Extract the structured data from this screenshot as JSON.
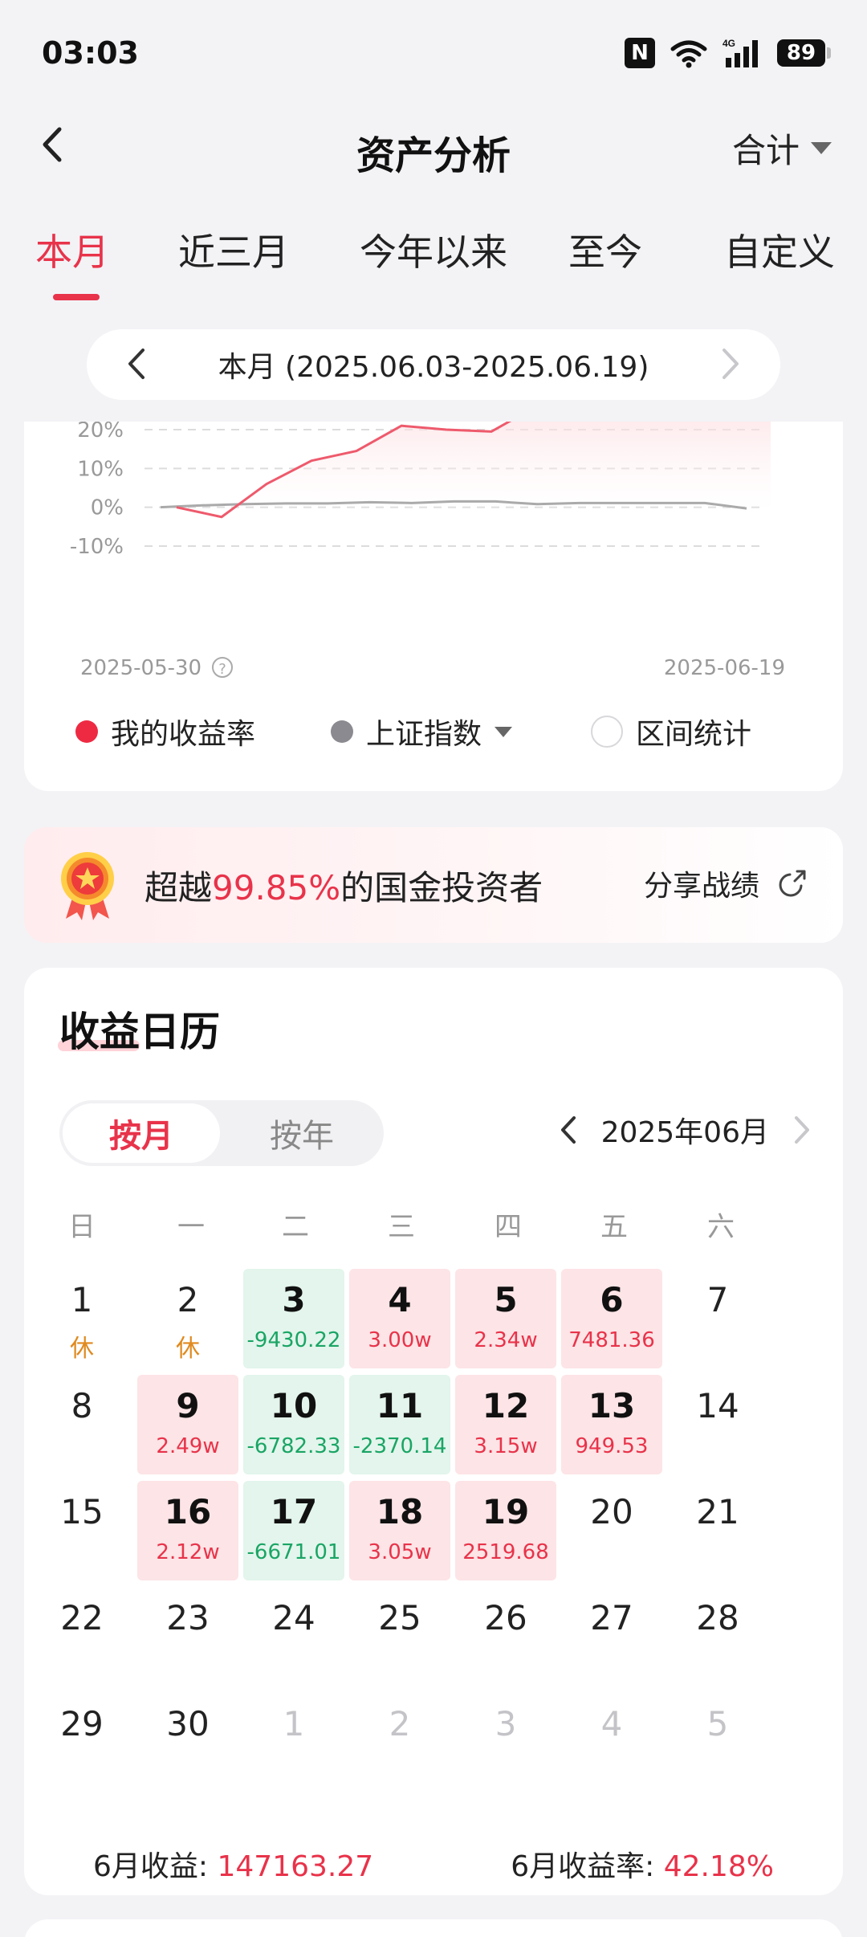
{
  "status_bar": {
    "time": "03:03",
    "battery": "89",
    "network": "4G"
  },
  "header": {
    "title": "资产分析",
    "dropdown_label": "合计"
  },
  "tabs": [
    {
      "label": "本月",
      "active": true
    },
    {
      "label": "近三月"
    },
    {
      "label": "今年以来"
    },
    {
      "label": "至今"
    },
    {
      "label": "自定义"
    }
  ],
  "range": {
    "text": "本月 (2025.06.03-2025.06.19)"
  },
  "chart": {
    "y_tick_labels": [
      "20%",
      "10%",
      "0%",
      "-10%"
    ],
    "x_start_label": "2025-05-30",
    "x_end_label": "2025-06-19",
    "legend": {
      "mine": "我的收益率",
      "index": "上证指数",
      "stats": "区间统计"
    }
  },
  "chart_data": {
    "type": "line",
    "ylim": [
      -10,
      20
    ],
    "series": [
      {
        "name": "我的收益率",
        "color": "#ee5a6c",
        "values": [
          0,
          -2.5,
          6,
          12,
          14.5,
          21,
          20,
          19.5,
          26
        ]
      },
      {
        "name": "上证指数",
        "color": "#aaaaaa",
        "values": [
          0,
          0.5,
          0.8,
          1,
          1,
          1.3,
          1.1,
          1.5,
          1.5,
          0.8,
          1.1,
          1.1,
          1.1,
          1.1,
          -0.3
        ]
      }
    ]
  },
  "rank": {
    "prefix": "超越",
    "percent": "99.85%",
    "suffix": "的国金投资者",
    "share": "分享战绩"
  },
  "calendar": {
    "title": "收益日历",
    "mode_month": "按月",
    "mode_year": "按年",
    "month_label": "2025年06月",
    "weekdays": [
      "日",
      "一",
      "二",
      "三",
      "四",
      "五",
      "六"
    ],
    "days": [
      {
        "d": "1",
        "sub": "休",
        "t": "rest"
      },
      {
        "d": "2",
        "sub": "休",
        "t": "rest"
      },
      {
        "d": "3",
        "sub": "-9430.22",
        "t": "neg"
      },
      {
        "d": "4",
        "sub": "3.00w",
        "t": "pos"
      },
      {
        "d": "5",
        "sub": "2.34w",
        "t": "pos"
      },
      {
        "d": "6",
        "sub": "7481.36",
        "t": "pos"
      },
      {
        "d": "7",
        "sub": "",
        "t": ""
      },
      {
        "d": "8",
        "sub": "",
        "t": ""
      },
      {
        "d": "9",
        "sub": "2.49w",
        "t": "pos"
      },
      {
        "d": "10",
        "sub": "-6782.33",
        "t": "neg"
      },
      {
        "d": "11",
        "sub": "-2370.14",
        "t": "neg"
      },
      {
        "d": "12",
        "sub": "3.15w",
        "t": "pos"
      },
      {
        "d": "13",
        "sub": "949.53",
        "t": "pos"
      },
      {
        "d": "14",
        "sub": "",
        "t": ""
      },
      {
        "d": "15",
        "sub": "",
        "t": ""
      },
      {
        "d": "16",
        "sub": "2.12w",
        "t": "pos"
      },
      {
        "d": "17",
        "sub": "-6671.01",
        "t": "neg"
      },
      {
        "d": "18",
        "sub": "3.05w",
        "t": "pos"
      },
      {
        "d": "19",
        "sub": "2519.68",
        "t": "pos"
      },
      {
        "d": "20",
        "sub": "",
        "t": ""
      },
      {
        "d": "21",
        "sub": "",
        "t": ""
      },
      {
        "d": "22",
        "sub": "",
        "t": ""
      },
      {
        "d": "23",
        "sub": "",
        "t": ""
      },
      {
        "d": "24",
        "sub": "",
        "t": ""
      },
      {
        "d": "25",
        "sub": "",
        "t": ""
      },
      {
        "d": "26",
        "sub": "",
        "t": ""
      },
      {
        "d": "27",
        "sub": "",
        "t": ""
      },
      {
        "d": "28",
        "sub": "",
        "t": ""
      },
      {
        "d": "29",
        "sub": "",
        "t": ""
      },
      {
        "d": "30",
        "sub": "",
        "t": ""
      },
      {
        "d": "1",
        "sub": "",
        "t": "muted"
      },
      {
        "d": "2",
        "sub": "",
        "t": "muted"
      },
      {
        "d": "3",
        "sub": "",
        "t": "muted"
      },
      {
        "d": "4",
        "sub": "",
        "t": "muted"
      },
      {
        "d": "5",
        "sub": "",
        "t": "muted"
      }
    ],
    "month_income_label": "6月收益:",
    "month_income_value": "147163.27",
    "month_rate_label": "6月收益率:",
    "month_rate_value": "42.18%"
  }
}
